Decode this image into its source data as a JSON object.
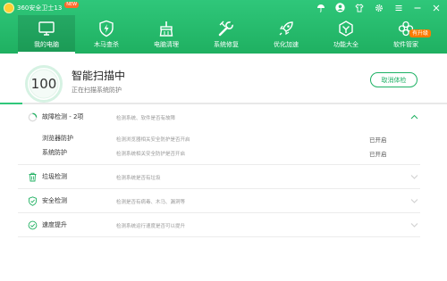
{
  "app": {
    "title": "360安全卫士13",
    "badge": "NEW"
  },
  "window_controls": [
    "umbrella-icon",
    "avatar-icon",
    "shirt-icon",
    "gear-icon",
    "menu-icon",
    "minimize-icon",
    "close-icon"
  ],
  "nav": {
    "items": [
      {
        "label": "我的电脑",
        "icon": "monitor-icon",
        "active": true
      },
      {
        "label": "木马查杀",
        "icon": "shield-bolt-icon"
      },
      {
        "label": "电脑清理",
        "icon": "broom-icon"
      },
      {
        "label": "系统修复",
        "icon": "wrench-icon"
      },
      {
        "label": "优化加速",
        "icon": "rocket-icon"
      },
      {
        "label": "功能大全",
        "icon": "grid-icon"
      },
      {
        "label": "软件管家",
        "icon": "flower-icon",
        "badge": "有升级"
      }
    ]
  },
  "scan": {
    "score": "100",
    "title": "智能扫描中",
    "subtitle": "正在扫描系统防护",
    "stop_button": "取消体检",
    "progress": 0.05
  },
  "checks": [
    {
      "title": "故障检测 - 2项",
      "desc": "检测系统、软件是否有故障",
      "icon": "spinner-icon",
      "expanded": true,
      "subitems": [
        {
          "title": "浏览器防护",
          "desc": "检测浏览器相关安全防护是否开启",
          "status": "已开启"
        },
        {
          "title": "系统防护",
          "desc": "检测系统相关安全防护是否开启",
          "status": "已开启"
        }
      ]
    },
    {
      "title": "垃圾检测",
      "desc": "检测系统是否有垃圾",
      "icon": "trash-icon"
    },
    {
      "title": "安全检测",
      "desc": "检测是否有病毒、木马、漏洞等",
      "icon": "shield-icon"
    },
    {
      "title": "速度提升",
      "desc": "检测系统运行速度是否可以提升",
      "icon": "speed-icon"
    }
  ],
  "colors": {
    "brand_green": "#1fb061",
    "accent_orange": "#ff7b00",
    "text_muted": "#999999"
  }
}
